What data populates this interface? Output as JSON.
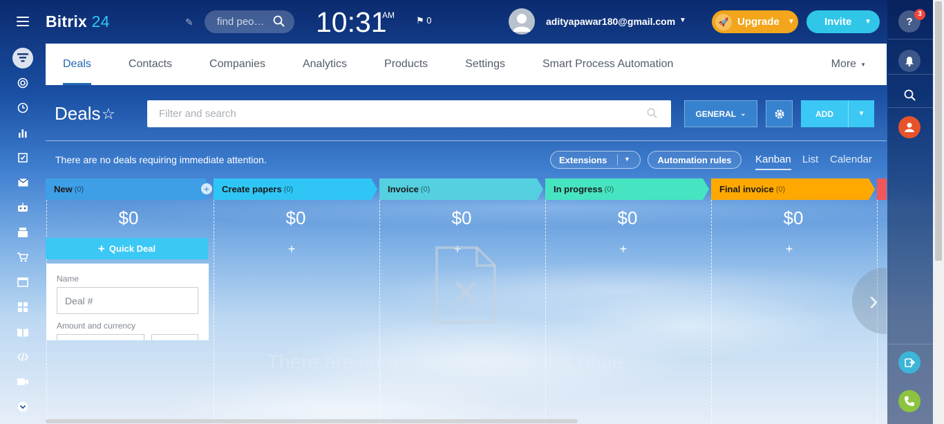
{
  "header": {
    "brand_name": "Bitrix",
    "brand_number": "24",
    "search_placeholder": "find peo…",
    "clock_time": "10:31",
    "clock_ampm": "AM",
    "flag_count": "0",
    "user_email": "adityapawar180@gmail.com",
    "upgrade_label": "Upgrade",
    "invite_label": "Invite"
  },
  "right_rail": {
    "help_label": "?",
    "help_badge": "3"
  },
  "nav": {
    "tabs": [
      {
        "label": "Deals"
      },
      {
        "label": "Contacts"
      },
      {
        "label": "Companies"
      },
      {
        "label": "Analytics"
      },
      {
        "label": "Products"
      },
      {
        "label": "Settings"
      },
      {
        "label": "Smart Process Automation"
      }
    ],
    "more_label": "More"
  },
  "toolbar": {
    "page_title": "Deals",
    "filter_placeholder": "Filter and search",
    "general_label": "GENERAL",
    "add_label": "ADD"
  },
  "status": {
    "attention_text": "There are no deals requiring immediate attention.",
    "extensions_label": "Extensions",
    "automation_label": "Automation rules",
    "views": [
      "Kanban",
      "List",
      "Calendar"
    ]
  },
  "kanban": {
    "columns": [
      {
        "name": "New",
        "count": "(0)",
        "amount": "$0",
        "color": "#3e9ee6"
      },
      {
        "name": "Create papers",
        "count": "(0)",
        "amount": "$0",
        "color": "#2fc6f5"
      },
      {
        "name": "Invoice",
        "count": "(0)",
        "amount": "$0",
        "color": "#55d0e0"
      },
      {
        "name": "In progress",
        "count": "(0)",
        "amount": "$0",
        "color": "#47e4c2"
      },
      {
        "name": "Final invoice",
        "count": "(0)",
        "amount": "$0",
        "color": "#ffa900"
      }
    ],
    "quick_deal_label": "Quick Deal",
    "form_name_label": "Name",
    "form_name_value": "Deal #",
    "form_amount_label": "Amount and currency",
    "empty_text": "There are currently no data on this page."
  }
}
